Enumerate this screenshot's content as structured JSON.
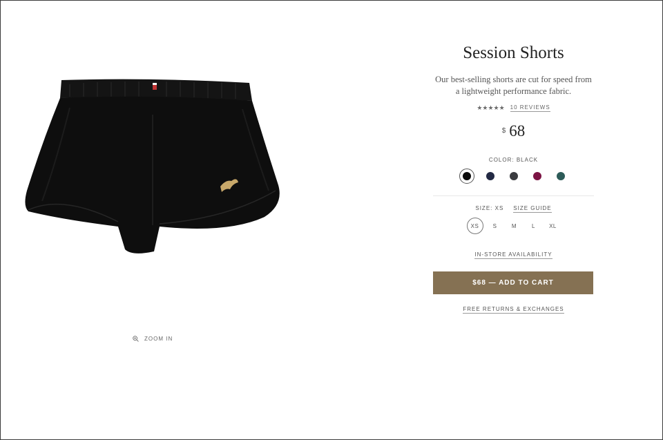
{
  "product": {
    "title": "Session Shorts",
    "description": "Our best-selling shorts are cut for speed from a lightweight performance fabric.",
    "rating": {
      "stars_text": "★★★★★",
      "stars_value": 4.5,
      "reviews_label": "10 REVIEWS"
    },
    "price": {
      "currency": "$",
      "amount": "68"
    },
    "color": {
      "label": "COLOR: BLACK",
      "swatches": [
        {
          "name": "black",
          "hex": "#0b0b0b",
          "selected": true
        },
        {
          "name": "navy",
          "hex": "#232a44",
          "selected": false
        },
        {
          "name": "charcoal",
          "hex": "#3b3c40",
          "selected": false
        },
        {
          "name": "maroon",
          "hex": "#7c1444",
          "selected": false
        },
        {
          "name": "teal",
          "hex": "#2d5b58",
          "selected": false
        }
      ]
    },
    "size": {
      "label": "SIZE: XS",
      "guide_label": "SIZE GUIDE",
      "options": [
        "XS",
        "S",
        "M",
        "L",
        "XL"
      ],
      "selected": "XS"
    },
    "in_store_label": "IN-STORE AVAILABILITY",
    "add_to_cart_label": "$68 — ADD TO CART",
    "returns_label": "FREE RETURNS & EXCHANGES"
  },
  "gallery": {
    "zoom_label": "ZOOM IN",
    "zoom_icon": "zoom-in-icon",
    "image_subject": "black running shorts"
  },
  "colors": {
    "button": "#857153"
  }
}
